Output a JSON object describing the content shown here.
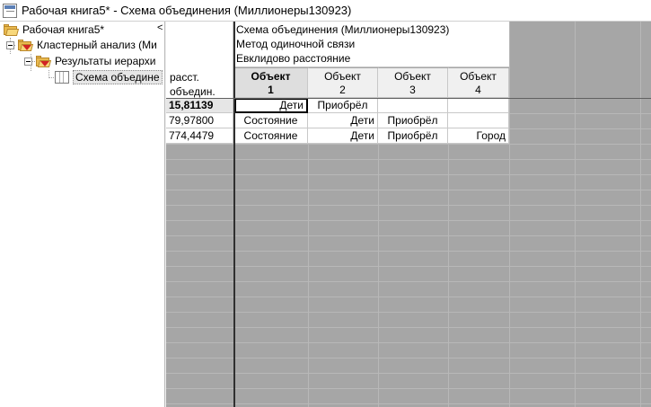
{
  "window": {
    "title": "Рабочая книга5* - Схема объединения (Миллионеры130923)"
  },
  "tree": {
    "collapse_glyph": "<",
    "items": [
      {
        "label": "Рабочая книга5*",
        "icon": "open-folder-icon"
      },
      {
        "label": "Кластерный анализ (Ми",
        "icon": "analysis-folder-icon"
      },
      {
        "label": "Результаты иерархи",
        "icon": "results-folder-icon"
      },
      {
        "label": "Схема объедине",
        "icon": "spreadsheet-icon"
      }
    ]
  },
  "sheet": {
    "header_lines": [
      "Схема объединения (Миллионеры130923)",
      "Метод одиночной связи",
      "Евклидово расстояние"
    ],
    "row_header_label_line1": "расст.",
    "row_header_label_line2": "объедин.",
    "columns": [
      {
        "line1": "Объект",
        "line2": "1"
      },
      {
        "line1": "Объект",
        "line2": "2"
      },
      {
        "line1": "Объект",
        "line2": "3"
      },
      {
        "line1": "Объект",
        "line2": "4"
      }
    ],
    "rows": [
      {
        "dist": "15,81139",
        "cells": [
          "Дети",
          "Приобрёл",
          "",
          ""
        ]
      },
      {
        "dist": "79,97800",
        "cells": [
          "Состояние",
          "Дети",
          "Приобрёл",
          ""
        ]
      },
      {
        "dist": "774,4479",
        "cells": [
          "Состояние",
          "Дети",
          "Приобрёл",
          "Город"
        ]
      }
    ]
  }
}
